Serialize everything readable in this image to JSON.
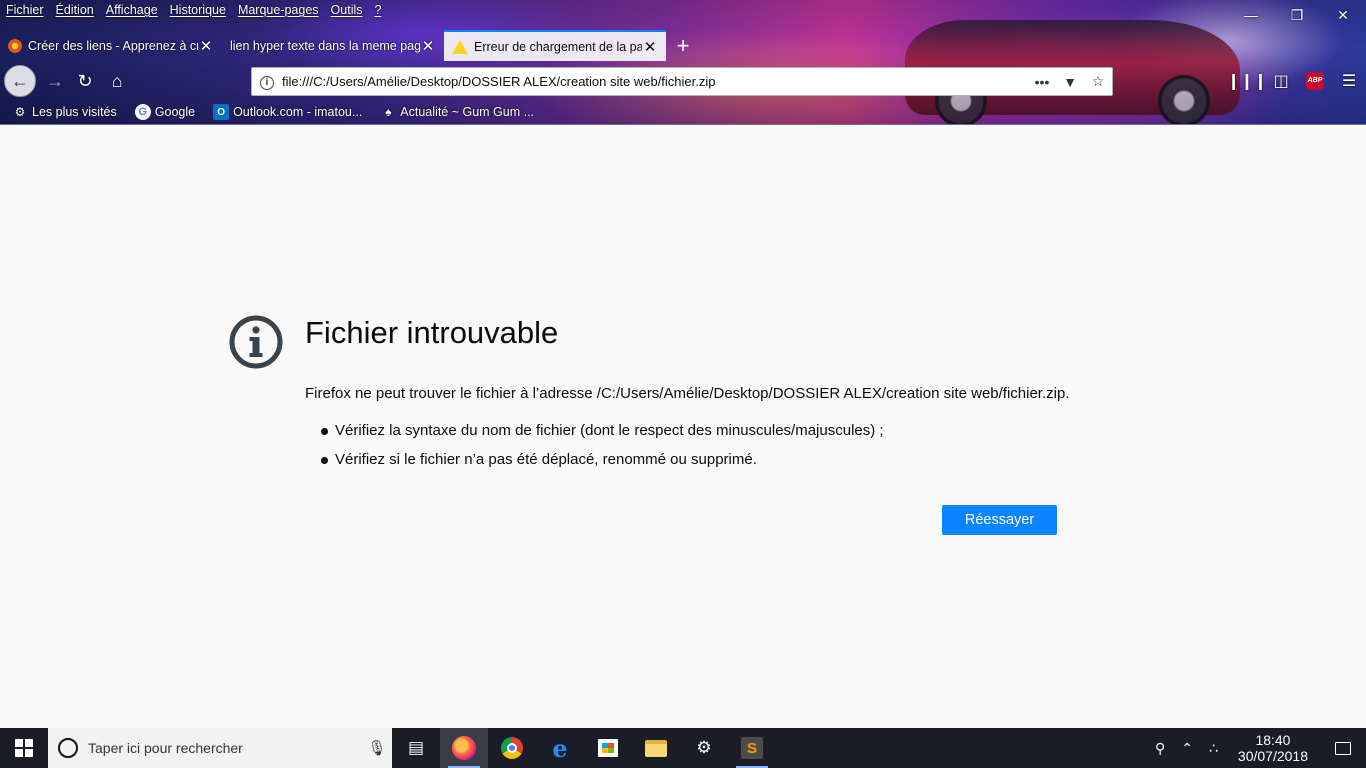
{
  "menu": [
    "Fichier",
    "Édition",
    "Affichage",
    "Historique",
    "Marque-pages",
    "Outils",
    "?"
  ],
  "tabs": [
    {
      "label": "Créer des liens - Apprenez à créer",
      "icon": "openclassrooms-icon",
      "active": false
    },
    {
      "label": "lien hyper texte dans la meme page",
      "icon": "",
      "active": false
    },
    {
      "label": "Erreur de chargement de la page",
      "icon": "warning-icon",
      "active": true
    }
  ],
  "url": "file:///C:/Users/Amélie/Desktop/DOSSIER ALEX/creation site web/fichier.zip",
  "bookmarks": [
    {
      "label": "Les plus visités",
      "icon": "gear-icon"
    },
    {
      "label": "Google",
      "icon": "google-icon"
    },
    {
      "label": "Outlook.com - imatou...",
      "icon": "outlook-icon"
    },
    {
      "label": "Actualité ~ Gum Gum ...",
      "icon": "gumgum-icon"
    }
  ],
  "error": {
    "title": "Fichier introuvable",
    "description": "Firefox ne peut trouver le fichier à l’adresse /C:/Users/Amélie/Desktop/DOSSIER ALEX/creation site web/fichier.zip.",
    "bullets": [
      "Vérifiez la syntaxe du nom de fichier (dont le respect des minuscules/majuscules) ;",
      "Vérifiez si le fichier n’a pas été déplacé, renommé ou supprimé."
    ],
    "retry_label": "Réessayer"
  },
  "taskbar": {
    "search_placeholder": "Taper ici pour rechercher",
    "time": "18:40",
    "date": "30/07/2018"
  },
  "colors": {
    "accent": "#0a84ff",
    "page_bg": "#f9f9fa",
    "icon_gray": "#3a424a"
  }
}
